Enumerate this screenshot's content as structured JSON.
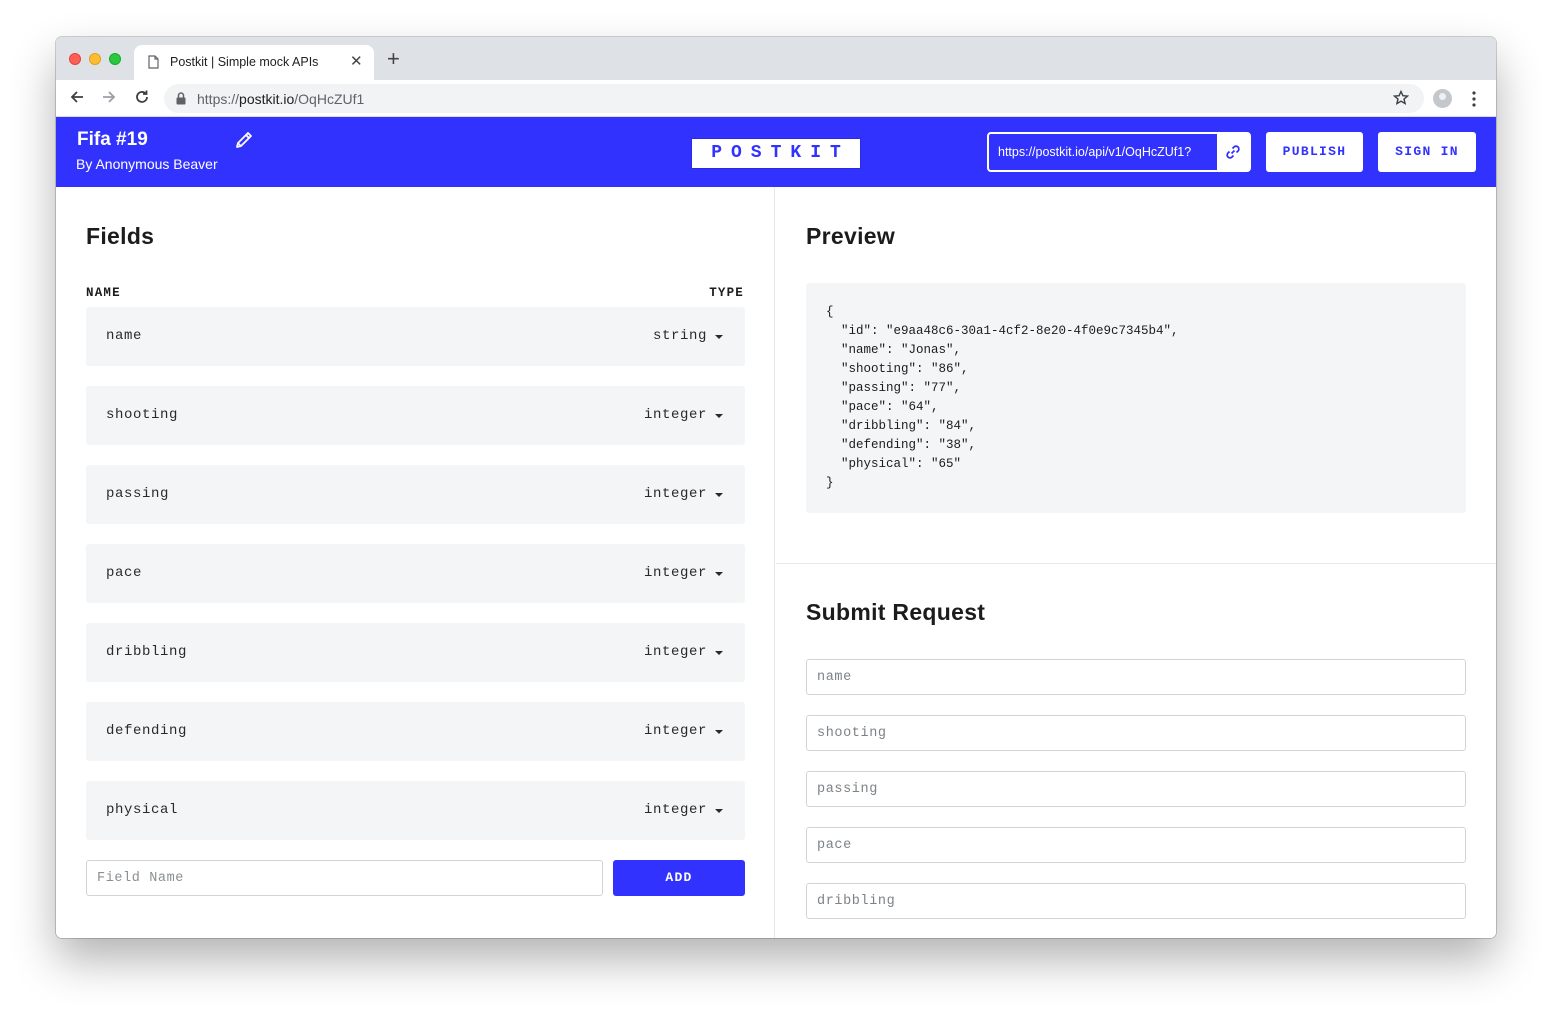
{
  "browser": {
    "tab_title": "Postkit | Simple mock APIs",
    "url_scheme": "https://",
    "url_host": "postkit.io",
    "url_path": "/OqHcZUf1"
  },
  "header": {
    "project_title": "Fifa #19",
    "author": "By Anonymous Beaver",
    "logo": "POSTKIT",
    "api_url": "https://postkit.io/api/v1/OqHcZUf1?",
    "publish_label": "PUBLISH",
    "signin_label": "SIGN IN",
    "brand_color": "#3232ff"
  },
  "fields_panel": {
    "title": "Fields",
    "col_name": "NAME",
    "col_type": "TYPE",
    "fields": [
      {
        "name": "name",
        "type": "string"
      },
      {
        "name": "shooting",
        "type": "integer"
      },
      {
        "name": "passing",
        "type": "integer"
      },
      {
        "name": "pace",
        "type": "integer"
      },
      {
        "name": "dribbling",
        "type": "integer"
      },
      {
        "name": "defending",
        "type": "integer"
      },
      {
        "name": "physical",
        "type": "integer"
      }
    ],
    "new_field_placeholder": "Field Name",
    "add_label": "ADD"
  },
  "preview": {
    "title": "Preview",
    "code": "{\n  \"id\": \"e9aa48c6-30a1-4cf2-8e20-4f0e9c7345b4\",\n  \"name\": \"Jonas\",\n  \"shooting\": \"86\",\n  \"passing\": \"77\",\n  \"pace\": \"64\",\n  \"dribbling\": \"84\",\n  \"defending\": \"38\",\n  \"physical\": \"65\"\n}"
  },
  "submit": {
    "title": "Submit Request",
    "inputs": [
      {
        "placeholder": "name"
      },
      {
        "placeholder": "shooting"
      },
      {
        "placeholder": "passing"
      },
      {
        "placeholder": "pace"
      },
      {
        "placeholder": "dribbling"
      }
    ]
  }
}
